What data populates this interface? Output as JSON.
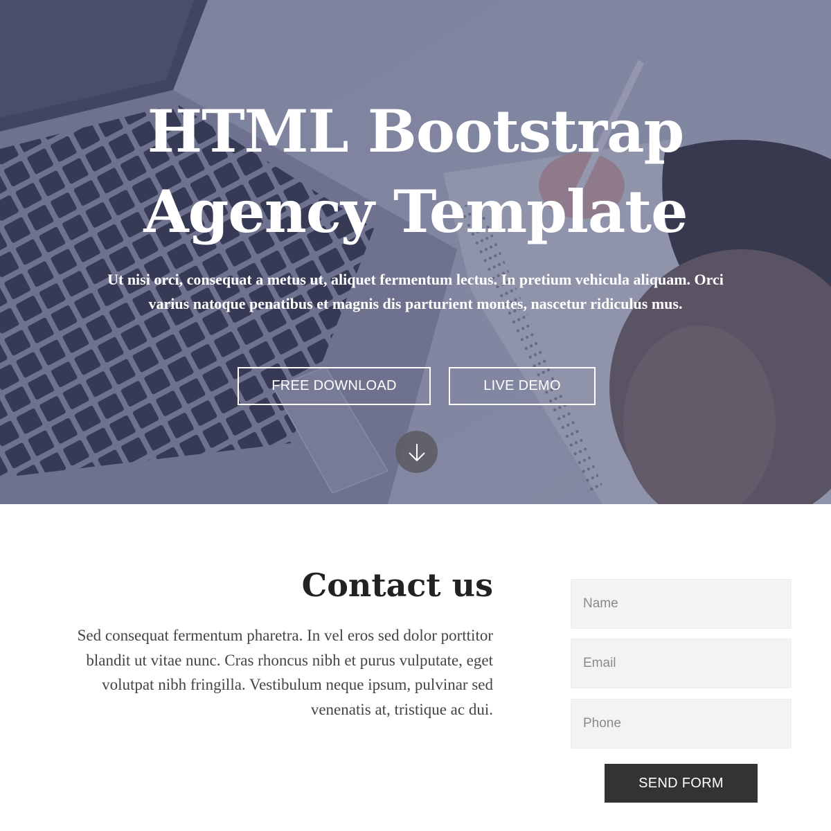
{
  "hero": {
    "title_line1": "HTML Bootstrap",
    "title_line2": "Agency Template",
    "text": "Ut nisi orci, consequat a metus ut, aliquet fermentum lectus. In pretium vehicula aliquam. Orci varius natoque penatibus et magnis dis parturient montes, nascetur ridiculus mus.",
    "download_label": "FREE DOWNLOAD",
    "demo_label": "LIVE DEMO",
    "scroll_icon": "arrow-down-icon",
    "overlay_color": "#464c70"
  },
  "contact": {
    "title": "Contact us",
    "text": "Sed consequat fermentum pharetra. In vel eros sed dolor porttitor blandit ut vitae nunc. Cras rhoncus nibh et purus vulputate, eget volutpat nibh fringilla. Vestibulum neque ipsum, pulvinar sed venenatis at, tristique ac dui.",
    "form": {
      "name_placeholder": "Name",
      "email_placeholder": "Email",
      "phone_placeholder": "Phone",
      "name_value": "",
      "email_value": "",
      "phone_value": "",
      "submit_label": "SEND FORM",
      "submit_color": "#333333"
    }
  }
}
